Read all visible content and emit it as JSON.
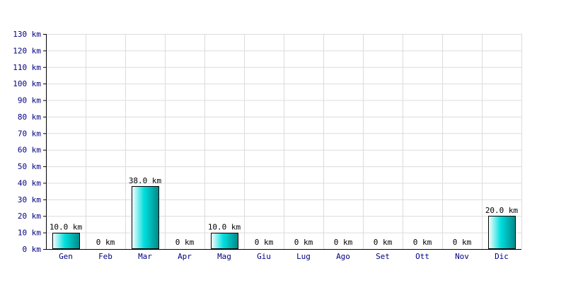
{
  "chart_data": {
    "type": "bar",
    "categories": [
      "Gen",
      "Feb",
      "Mar",
      "Apr",
      "Mag",
      "Giu",
      "Lug",
      "Ago",
      "Set",
      "Ott",
      "Nov",
      "Dic"
    ],
    "values": [
      10.0,
      0,
      38.0,
      0,
      10.0,
      0,
      0,
      0,
      0,
      0,
      0,
      20.0
    ],
    "data_labels": [
      "10.0 km",
      "0 km",
      "38.0 km",
      "0 km",
      "10.0 km",
      "0 km",
      "0 km",
      "0 km",
      "0 km",
      "0 km",
      "0 km",
      "20.0 km"
    ],
    "y_ticks": [
      "0 km",
      "10 km",
      "20 km",
      "30 km",
      "40 km",
      "50 km",
      "60 km",
      "70 km",
      "80 km",
      "90 km",
      "100 km",
      "110 km",
      "120 km",
      "130 km"
    ],
    "ylim": [
      0,
      130
    ],
    "y_step": 10,
    "grid": true,
    "colors": {
      "bar_fill_light": "#ffffff",
      "bar_fill_mid": "#00dede",
      "bar_fill_dark": "#008888",
      "bar_stroke": "#000000",
      "grid": "#dcdcdc",
      "axis": "#000000",
      "tick_text": "#000080"
    }
  }
}
